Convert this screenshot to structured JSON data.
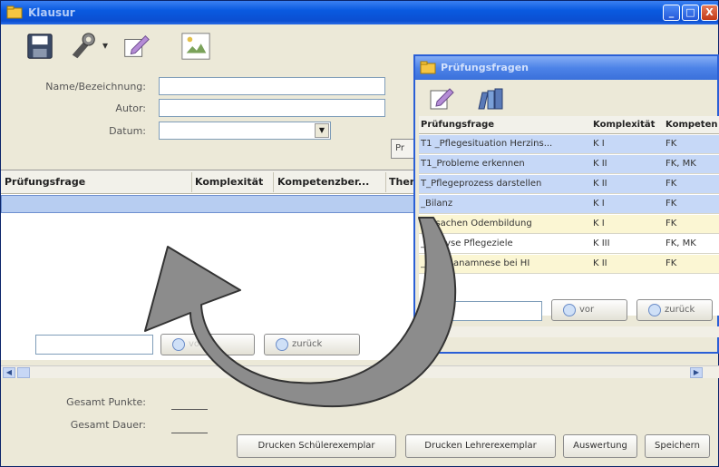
{
  "main_window": {
    "title": "Klausur",
    "controls": {
      "minimize": "_",
      "maximize": "□",
      "close": "X"
    }
  },
  "toolbar": {
    "icons": [
      "save-icon",
      "tools-icon",
      "edit-icon",
      "image-icon"
    ],
    "dropdown_arrow": "▾"
  },
  "form": {
    "name_label": "Name/Bezeichnung:",
    "name_value": "",
    "author_label": "Autor:",
    "author_value": "",
    "date_label": "Datum:",
    "date_value": "",
    "combo_arrow": "▼"
  },
  "partial_button_label": "Pr",
  "main_grid": {
    "columns": [
      "Prüfungsfrage",
      "Komplexität",
      "Kompetenzber...",
      "Ther"
    ]
  },
  "main_nav": {
    "search_value": "",
    "forward_label": "vor",
    "back_label": "zurück"
  },
  "scrollbar": {
    "left_arrow": "◀",
    "right_arrow": "▶"
  },
  "totals": {
    "points_label": "Gesamt Punkte:",
    "duration_label": "Gesamt Dauer:"
  },
  "bottom_buttons": {
    "print_student": "Drucken Schülerexemplar",
    "print_teacher": "Drucken Lehrerexemplar",
    "evaluation": "Auswertung",
    "save": "Speichern"
  },
  "child_window": {
    "title": "Prüfungsfragen",
    "toolbar_icons": [
      "edit-icon",
      "library-icon"
    ],
    "columns": [
      "Prüfungsfrage",
      "Komplexität",
      "Kompeten"
    ],
    "rows": [
      {
        "frage": "T1 _Pflegesituation Herzins...",
        "komplex": "K I",
        "kompetenz": "FK",
        "style": "sel"
      },
      {
        "frage": "T1_Probleme erkennen",
        "komplex": "K II",
        "kompetenz": "FK, MK",
        "style": "sel"
      },
      {
        "frage": "T_Pflegeprozess darstellen",
        "komplex": "K II",
        "kompetenz": "FK",
        "style": "sel"
      },
      {
        "frage": "_Bilanz",
        "komplex": "K I",
        "kompetenz": "FK",
        "style": "sel"
      },
      {
        "frage": "_Ursachen Ödembildung",
        "komplex": "K I",
        "kompetenz": "FK",
        "style": "alt"
      },
      {
        "frage": "_Analyse Pflegeziele",
        "komplex": "K III",
        "kompetenz": "FK, MK",
        "style": "plain"
      },
      {
        "frage": "_Pflegeanamnese bei HI",
        "komplex": "K II",
        "kompetenz": "FK",
        "style": "alt"
      }
    ],
    "search_value": "",
    "forward_label": "vor",
    "back_label": "zurück"
  }
}
